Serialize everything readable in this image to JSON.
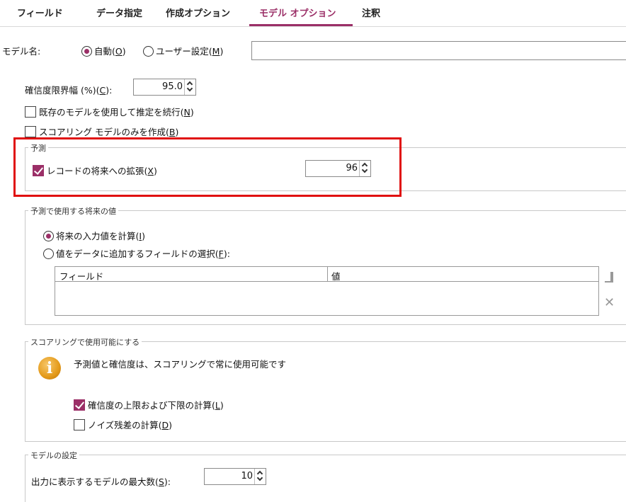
{
  "tabs": [
    "フィールド",
    "データ指定",
    "作成オプション",
    "モデル オプション",
    "注釈"
  ],
  "model_name": {
    "label": "モデル名:",
    "auto_text": "自動(",
    "auto_key": "O",
    "user_text": "ユーザー設定(",
    "user_key": "M",
    "close_paren": ")"
  },
  "confidence": {
    "label": "確信度限界幅 (%)(",
    "key": "C",
    "close": "):",
    "value": "95.0"
  },
  "continue_est": {
    "text": "既存のモデルを使用して推定を続行(",
    "key": "N",
    "close": ")",
    "checked": false
  },
  "scoring_only": {
    "text": "スコアリング モデルのみを作成(",
    "key": "B",
    "close": ")",
    "checked": false
  },
  "forecast": {
    "title": "予測",
    "extend": {
      "text": "レコードの将来への拡張(",
      "key": "X",
      "close": ")",
      "checked": true
    },
    "periods": "96"
  },
  "future_values": {
    "title": "予測で使用する将来の値",
    "compute": {
      "text": "将来の入力値を計算(",
      "key": "I",
      "close": ")"
    },
    "select": {
      "text": "値をデータに追加するフィールドの選択(",
      "key": "F",
      "close": "):"
    },
    "columns": [
      "フィールド",
      "値"
    ]
  },
  "scoring": {
    "title": "スコアリングで使用可能にする",
    "info": "予測値と確信度は、スコアリングで常に使用可能です",
    "bounds": {
      "text": "確信度の上限および下限の計算(",
      "key": "L",
      "close": ")",
      "checked": true
    },
    "noise": {
      "text": "ノイズ残差の計算(",
      "key": "D",
      "close": ")",
      "checked": false
    }
  },
  "model_settings": {
    "title": "モデルの設定",
    "max_label": "出力に表示するモデルの最大数(",
    "max_key": "S",
    "max_close": "):",
    "max_value": "10"
  },
  "accent_color": "#9b2f67",
  "highlight_color": "#e01010"
}
